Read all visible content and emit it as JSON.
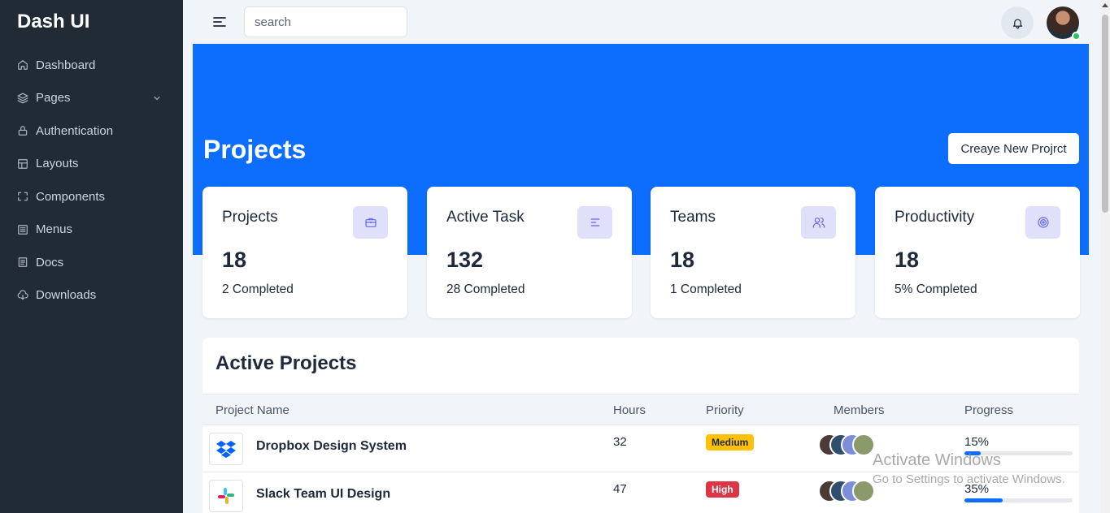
{
  "app": {
    "brand": "Dash UI"
  },
  "sidebar": {
    "items": [
      {
        "label": "Dashboard",
        "icon": "home-icon"
      },
      {
        "label": "Pages",
        "icon": "layers-icon",
        "has_submenu": true
      },
      {
        "label": "Authentication",
        "icon": "lock-icon"
      },
      {
        "label": "Layouts",
        "icon": "layout-icon"
      },
      {
        "label": "Components",
        "icon": "components-icon"
      },
      {
        "label": "Menus",
        "icon": "menu-list-icon"
      },
      {
        "label": "Docs",
        "icon": "docs-icon"
      },
      {
        "label": "Downloads",
        "icon": "cloud-download-icon"
      }
    ]
  },
  "topbar": {
    "search_placeholder": "search"
  },
  "hero": {
    "title": "Projects",
    "button_label": "Creaye New Projrct"
  },
  "stats": [
    {
      "title": "Projects",
      "value": "18",
      "sub": "2 Completed",
      "icon": "briefcase-icon"
    },
    {
      "title": "Active Task",
      "value": "132",
      "sub": "28 Completed",
      "icon": "list-icon"
    },
    {
      "title": "Teams",
      "value": "18",
      "sub": "1 Completed",
      "icon": "users-icon"
    },
    {
      "title": "Productivity",
      "value": "18",
      "sub": "5% Completed",
      "icon": "target-icon"
    }
  ],
  "active_projects": {
    "title": "Active Projects",
    "columns": {
      "name": "Project Name",
      "hours": "Hours",
      "priority": "Priority",
      "members": "Members",
      "progress": "Progress"
    },
    "rows": [
      {
        "name": "Dropbox Design System",
        "hours": "32",
        "priority": "Medium",
        "priority_color": "#ffc107",
        "progress_label": "15%",
        "progress": 15,
        "logo": "dropbox-icon"
      },
      {
        "name": "Slack Team UI Design",
        "hours": "47",
        "priority": "High",
        "priority_color": "#dc3545",
        "progress_label": "35%",
        "progress": 35,
        "logo": "slack-icon"
      }
    ]
  },
  "watermark": {
    "line1": "Activate Windows",
    "line2": "Go to Settings to activate Windows."
  },
  "colors": {
    "sidebar": "#212b36",
    "primary": "#0d6efd",
    "icon_bg": "#e0e0fb",
    "icon": "#6366f1",
    "online": "#22c55e"
  }
}
